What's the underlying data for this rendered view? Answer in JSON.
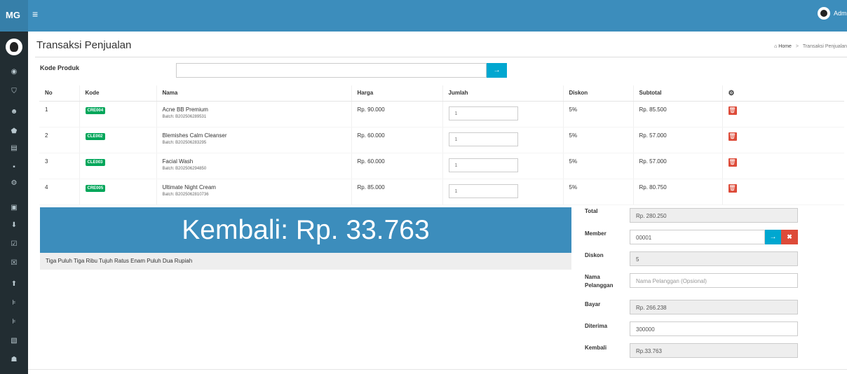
{
  "header": {
    "logo": "MG",
    "menu_icon": "hamburger-icon",
    "user_name": "Admin"
  },
  "sidebar": {
    "icons": [
      "dashboard-icon",
      "shield-icon",
      "users-icon",
      "tag-icon",
      "grid-icon",
      "truck-icon",
      "cogs-icon",
      "monitor-icon",
      "download-icon",
      "check-square-icon",
      "check-box-icon",
      "upload-icon",
      "cart-icon",
      "cart-icon",
      "report-icon",
      "group-icon"
    ]
  },
  "page": {
    "title": "Transaksi Penjualan",
    "breadcrumb_home": "Home",
    "breadcrumb_sep": ">",
    "breadcrumb_current": "Transaksi Penjualan"
  },
  "product_search": {
    "label": "Kode Produk",
    "value": "",
    "submit_icon": "→"
  },
  "table": {
    "headers": {
      "no": "No",
      "kode": "Kode",
      "nama": "Nama",
      "harga": "Harga",
      "jumlah": "Jumlah",
      "diskon": "Diskon",
      "subtotal": "Subtotal",
      "action_icon": "⚙"
    },
    "rows": [
      {
        "no": "1",
        "kode": "CRE004",
        "nama": "Acne BB Premium",
        "batch": "Batch: B202506289531",
        "harga": "Rp. 90.000",
        "jumlah": "1",
        "diskon": "5%",
        "subtotal": "Rp. 85.500"
      },
      {
        "no": "2",
        "kode": "CLE002",
        "nama": "Blemishes Calm Cleanser",
        "batch": "Batch: B202506283295",
        "harga": "Rp. 60.000",
        "jumlah": "1",
        "diskon": "5%",
        "subtotal": "Rp. 57.000"
      },
      {
        "no": "3",
        "kode": "CLE003",
        "nama": "Facial Wash",
        "batch": "Batch: B202506294850",
        "harga": "Rp. 60.000",
        "jumlah": "1",
        "diskon": "5%",
        "subtotal": "Rp. 57.000"
      },
      {
        "no": "4",
        "kode": "CRE005",
        "nama": "Ultimate Night Cream",
        "batch": "Batch: B2025062810736",
        "harga": "Rp. 85.000",
        "jumlah": "1",
        "diskon": "5%",
        "subtotal": "Rp. 80.750"
      }
    ],
    "delete_icon": "🗑"
  },
  "kembali_banner": "Kembali: Rp. 33.763",
  "terbilang": "Tiga Puluh Tiga Ribu Tujuh Ratus Enam Puluh Dua Rupiah",
  "summary": {
    "total": {
      "label": "Total",
      "value": "Rp. 280.250"
    },
    "member": {
      "label": "Member",
      "value": "00001",
      "go_icon": "→",
      "clear_icon": "✖"
    },
    "diskon": {
      "label": "Diskon",
      "value": "5"
    },
    "nama_pelanggan": {
      "label_line1": "Nama",
      "label_line2": "Pelanggan",
      "placeholder": "Nama Pelanggan (Opsional)"
    },
    "bayar": {
      "label": "Bayar",
      "value": "Rp. 266.238"
    },
    "diterima": {
      "label": "Diterima",
      "value": "300000"
    },
    "kembali": {
      "label": "Kembali",
      "value": "Rp.33.763"
    }
  },
  "colors": {
    "header": "#3c8dbc",
    "sidebar": "#222d32",
    "badge": "#00a65a",
    "danger": "#dd4b39",
    "info": "#00a7d0"
  }
}
